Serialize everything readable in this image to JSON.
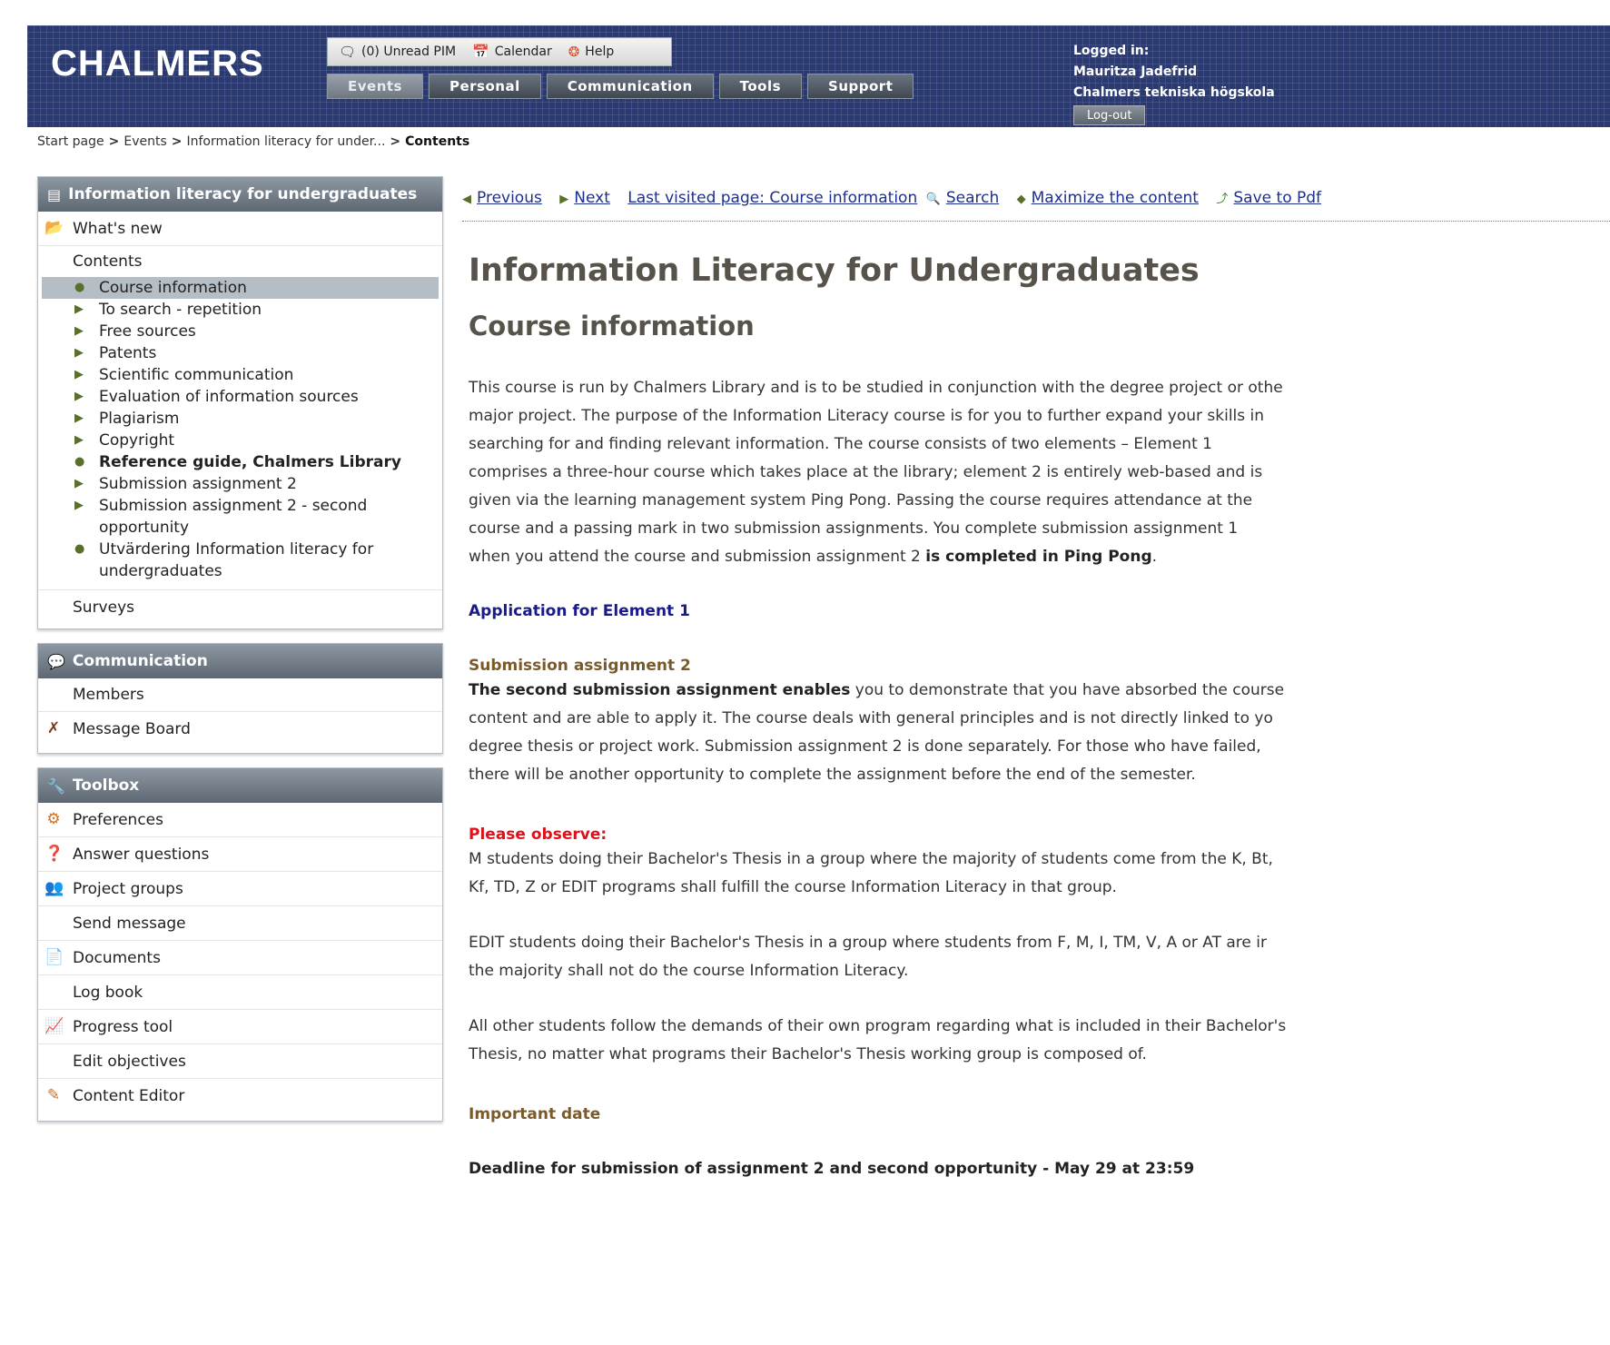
{
  "header": {
    "logo": "CHALMERS",
    "top_tools": [
      {
        "icon": "chat-bubble-icon",
        "label": "(0) Unread PIM"
      },
      {
        "icon": "calendar-icon",
        "label": "Calendar"
      },
      {
        "icon": "help-icon",
        "label": "Help"
      }
    ],
    "nav_tabs": [
      "Events",
      "Personal",
      "Communication",
      "Tools",
      "Support"
    ],
    "active_tab": "Events",
    "login": {
      "label": "Logged in:",
      "name": "Mauritza Jadefrid",
      "organization": "Chalmers tekniska högskola",
      "logout": "Log-out"
    },
    "colors": {
      "header_bg": "#2a3a70"
    }
  },
  "breadcrumb": {
    "items": [
      "Start page",
      "Events",
      "Information literacy for under..."
    ],
    "current": "Contents",
    "separator": ">"
  },
  "sidebar": {
    "course_panel": {
      "title": "Information literacy for undergraduates",
      "whats_new": "What's new",
      "contents": "Contents",
      "sub_items": [
        {
          "label": "Course information",
          "selected": true,
          "bold": false,
          "bullet": "dot"
        },
        {
          "label": "To search - repetition",
          "selected": false,
          "bold": false,
          "bullet": "triangle"
        },
        {
          "label": "Free sources",
          "selected": false,
          "bold": false,
          "bullet": "triangle"
        },
        {
          "label": "Patents",
          "selected": false,
          "bold": false,
          "bullet": "triangle"
        },
        {
          "label": "Scientific communication",
          "selected": false,
          "bold": false,
          "bullet": "triangle"
        },
        {
          "label": "Evaluation of information sources",
          "selected": false,
          "bold": false,
          "bullet": "triangle"
        },
        {
          "label": "Plagiarism",
          "selected": false,
          "bold": false,
          "bullet": "triangle"
        },
        {
          "label": "Copyright",
          "selected": false,
          "bold": false,
          "bullet": "triangle"
        },
        {
          "label": "Reference guide, Chalmers Library",
          "selected": false,
          "bold": true,
          "bullet": "dot"
        },
        {
          "label": "Submission assignment 2",
          "selected": false,
          "bold": false,
          "bullet": "triangle"
        },
        {
          "label": "Submission assignment 2 - second opportunity",
          "selected": false,
          "bold": false,
          "bullet": "triangle"
        },
        {
          "label": "Utvärdering Information literacy for undergraduates",
          "selected": false,
          "bold": false,
          "bullet": "dot"
        }
      ],
      "surveys": "Surveys"
    },
    "communication_panel": {
      "title": "Communication",
      "items": [
        {
          "label": "Members",
          "icon": ""
        },
        {
          "label": "Message Board",
          "icon": "pin-icon"
        }
      ]
    },
    "toolbox_panel": {
      "title": "Toolbox",
      "items": [
        {
          "label": "Preferences",
          "icon": "preferences-icon"
        },
        {
          "label": "Answer questions",
          "icon": "questions-icon"
        },
        {
          "label": "Project groups",
          "icon": "group-icon"
        },
        {
          "label": "Send message",
          "icon": ""
        },
        {
          "label": "Documents",
          "icon": "documents-icon"
        },
        {
          "label": "Log book",
          "icon": ""
        },
        {
          "label": "Progress tool",
          "icon": "chart-icon"
        },
        {
          "label": "Edit objectives",
          "icon": ""
        },
        {
          "label": "Content Editor",
          "icon": "edit-icon"
        }
      ]
    }
  },
  "toolbar": {
    "previous": "Previous",
    "next": "Next",
    "last_visited": "Last visited page: Course information",
    "search": "Search",
    "maximize": "Maximize the content",
    "save_pdf": "Save to Pdf"
  },
  "main": {
    "title": "Information Literacy for Undergraduates",
    "subtitle": "Course information",
    "intro_lines": [
      "This course is run by Chalmers Library and is to be studied in conjunction with the degree project or othe",
      "major project. The purpose of the Information Literacy course is for you to further expand your skills in",
      "searching for and finding relevant information. The course consists of two elements – Element 1",
      "comprises a three-hour course which takes place at the library; element 2 is entirely web-based and is",
      "given via the learning management system Ping Pong. Passing the course requires attendance at the",
      "course and a passing mark in two submission assignments. You complete submission assignment 1"
    ],
    "intro_last": {
      "a": "when you attend the course and submission assignment 2 ",
      "b": "is completed in Ping Pong",
      "c": "."
    },
    "application_heading": "Application for Element 1",
    "submission_heading": "Submission assignment 2",
    "submission_first": {
      "bold": "The second submission assignment enables",
      "rest": " you to demonstrate that you have absorbed the course"
    },
    "submission_lines": [
      "content and are able to apply it. The course deals with general principles and is not directly linked to yo",
      "degree thesis or project work. Submission assignment 2 is done separately. For those who have failed,",
      "there will be another opportunity to complete the assignment before the end of the semester."
    ],
    "observe_heading": "Please observe:",
    "observe_p1": [
      "M students doing their Bachelor's Thesis in a group where the majority of students come from the K, Bt,",
      "Kf, TD, Z or EDIT programs shall fulfill the course Information Literacy in that group."
    ],
    "observe_p2": [
      "EDIT students doing their Bachelor's Thesis in a group where students from F, M, I, TM, V, A or AT are ir",
      "the majority shall not do the course Information Literacy."
    ],
    "observe_p3": [
      "All other students follow the demands of their own program regarding what is included in their Bachelor's",
      "Thesis, no matter what programs their Bachelor's Thesis working group is composed of."
    ],
    "date_heading": "Important date",
    "deadline": "Deadline for submission of assignment 2 and second opportunity  - May 29 at 23:59"
  }
}
